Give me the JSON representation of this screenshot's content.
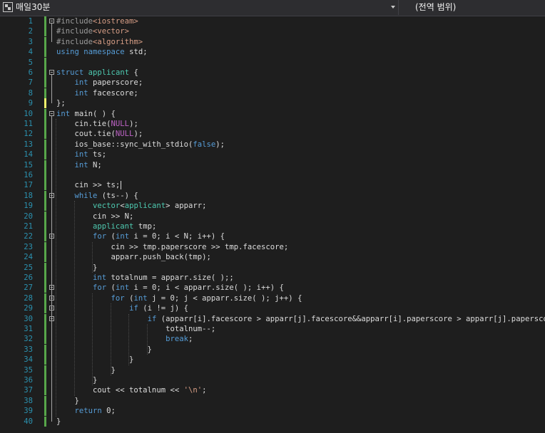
{
  "toolbar": {
    "project_label": "매일30분",
    "scope_label": "(전역 범위)"
  },
  "editor": {
    "line_numbers": [
      "1",
      "2",
      "3",
      "4",
      "5",
      "6",
      "7",
      "8",
      "9",
      "10",
      "11",
      "12",
      "13",
      "14",
      "15",
      "16",
      "17",
      "18",
      "19",
      "20",
      "21",
      "22",
      "23",
      "24",
      "25",
      "26",
      "27",
      "28",
      "29",
      "30",
      "31",
      "32",
      "33",
      "34",
      "35",
      "36",
      "37",
      "38",
      "39",
      "40"
    ],
    "lines": [
      [
        {
          "t": "#include",
          "c": "pp"
        },
        {
          "t": "<iostream>",
          "c": "inc"
        }
      ],
      [
        {
          "t": "#include",
          "c": "pp"
        },
        {
          "t": "<vector>",
          "c": "inc"
        }
      ],
      [
        {
          "t": "#include",
          "c": "pp"
        },
        {
          "t": "<algorithm>",
          "c": "inc"
        }
      ],
      [
        {
          "t": "using",
          "c": "kw"
        },
        {
          "t": " ",
          "c": ""
        },
        {
          "t": "namespace",
          "c": "kw"
        },
        {
          "t": " std;",
          "c": ""
        }
      ],
      [],
      [
        {
          "t": "struct",
          "c": "kw"
        },
        {
          "t": " ",
          "c": ""
        },
        {
          "t": "applicant",
          "c": "ty"
        },
        {
          "t": " {",
          "c": ""
        }
      ],
      [
        {
          "t": "    ",
          "c": ""
        },
        {
          "t": "int",
          "c": "kw"
        },
        {
          "t": " paperscore;",
          "c": ""
        }
      ],
      [
        {
          "t": "    ",
          "c": ""
        },
        {
          "t": "int",
          "c": "kw"
        },
        {
          "t": " facescore;",
          "c": ""
        }
      ],
      [
        {
          "t": "};",
          "c": ""
        }
      ],
      [
        {
          "t": "int",
          "c": "kw"
        },
        {
          "t": " main( ) {",
          "c": ""
        }
      ],
      [
        {
          "t": "    cin.tie(",
          "c": ""
        },
        {
          "t": "NULL",
          "c": "mac"
        },
        {
          "t": ");",
          "c": ""
        }
      ],
      [
        {
          "t": "    cout.tie(",
          "c": ""
        },
        {
          "t": "NULL",
          "c": "mac"
        },
        {
          "t": ");",
          "c": ""
        }
      ],
      [
        {
          "t": "    ios_base::sync_with_stdio(",
          "c": ""
        },
        {
          "t": "false",
          "c": "kw"
        },
        {
          "t": ");",
          "c": ""
        }
      ],
      [
        {
          "t": "    ",
          "c": ""
        },
        {
          "t": "int",
          "c": "kw"
        },
        {
          "t": " ts;",
          "c": ""
        }
      ],
      [
        {
          "t": "    ",
          "c": ""
        },
        {
          "t": "int",
          "c": "kw"
        },
        {
          "t": " N;",
          "c": ""
        }
      ],
      [],
      [
        {
          "t": "    cin >> ts;",
          "c": ""
        }
      ],
      [
        {
          "t": "    ",
          "c": ""
        },
        {
          "t": "while",
          "c": "kw"
        },
        {
          "t": " (ts--) {",
          "c": ""
        }
      ],
      [
        {
          "t": "        ",
          "c": ""
        },
        {
          "t": "vector",
          "c": "ty"
        },
        {
          "t": "<",
          "c": ""
        },
        {
          "t": "applicant",
          "c": "ty"
        },
        {
          "t": "> apparr;",
          "c": ""
        }
      ],
      [
        {
          "t": "        cin >> N;",
          "c": ""
        }
      ],
      [
        {
          "t": "        ",
          "c": ""
        },
        {
          "t": "applicant",
          "c": "ty"
        },
        {
          "t": " tmp;",
          "c": ""
        }
      ],
      [
        {
          "t": "        ",
          "c": ""
        },
        {
          "t": "for",
          "c": "kw"
        },
        {
          "t": " (",
          "c": ""
        },
        {
          "t": "int",
          "c": "kw"
        },
        {
          "t": " i = 0; i < N; i++) {",
          "c": ""
        }
      ],
      [
        {
          "t": "            cin >> tmp.paperscore >> tmp.facescore;",
          "c": ""
        }
      ],
      [
        {
          "t": "            apparr.push_back(tmp);",
          "c": ""
        }
      ],
      [
        {
          "t": "        }",
          "c": ""
        }
      ],
      [
        {
          "t": "        ",
          "c": ""
        },
        {
          "t": "int",
          "c": "kw"
        },
        {
          "t": " totalnum = apparr.size( );;",
          "c": ""
        }
      ],
      [
        {
          "t": "        ",
          "c": ""
        },
        {
          "t": "for",
          "c": "kw"
        },
        {
          "t": " (",
          "c": ""
        },
        {
          "t": "int",
          "c": "kw"
        },
        {
          "t": " i = 0; i < apparr.size( ); i++) {",
          "c": ""
        }
      ],
      [
        {
          "t": "            ",
          "c": ""
        },
        {
          "t": "for",
          "c": "kw"
        },
        {
          "t": " (",
          "c": ""
        },
        {
          "t": "int",
          "c": "kw"
        },
        {
          "t": " j = 0; j < apparr.size( ); j++) {",
          "c": ""
        }
      ],
      [
        {
          "t": "                ",
          "c": ""
        },
        {
          "t": "if",
          "c": "kw"
        },
        {
          "t": " (i != j) {",
          "c": ""
        }
      ],
      [
        {
          "t": "                    ",
          "c": ""
        },
        {
          "t": "if",
          "c": "kw"
        },
        {
          "t": " (apparr[i].facescore > apparr[j].facescore&&apparr[i].paperscore > apparr[j].paperscore) {",
          "c": ""
        }
      ],
      [
        {
          "t": "                        totalnum--;",
          "c": ""
        }
      ],
      [
        {
          "t": "                        ",
          "c": ""
        },
        {
          "t": "break",
          "c": "kw"
        },
        {
          "t": ";",
          "c": ""
        }
      ],
      [
        {
          "t": "                    }",
          "c": ""
        }
      ],
      [
        {
          "t": "                }",
          "c": ""
        }
      ],
      [
        {
          "t": "            }",
          "c": ""
        }
      ],
      [
        {
          "t": "        }",
          "c": ""
        }
      ],
      [
        {
          "t": "        cout << totalnum << ",
          "c": ""
        },
        {
          "t": "'\\n'",
          "c": "st"
        },
        {
          "t": ";",
          "c": ""
        }
      ],
      [
        {
          "t": "    }",
          "c": ""
        }
      ],
      [
        {
          "t": "    ",
          "c": ""
        },
        {
          "t": "return",
          "c": "kw"
        },
        {
          "t": " 0;",
          "c": ""
        }
      ],
      [
        {
          "t": "}",
          "c": ""
        }
      ]
    ],
    "colors": {
      "background": "#1e1e1e",
      "line_number": "#2b91af",
      "saved_change": "#57a64a",
      "unsaved_change": "#efef6b"
    }
  }
}
